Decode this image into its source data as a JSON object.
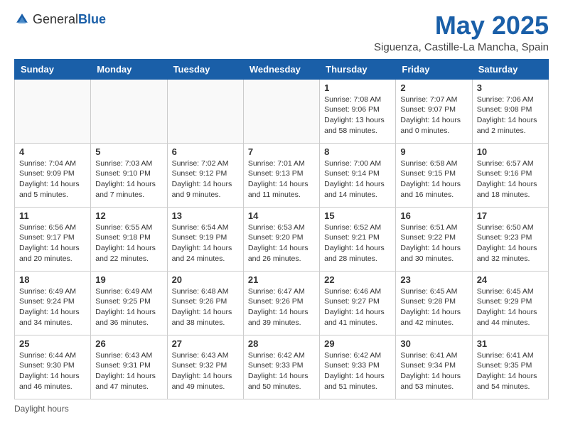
{
  "logo": {
    "general": "General",
    "blue": "Blue"
  },
  "title": "May 2025",
  "location": "Siguenza, Castille-La Mancha, Spain",
  "days_of_week": [
    "Sunday",
    "Monday",
    "Tuesday",
    "Wednesday",
    "Thursday",
    "Friday",
    "Saturday"
  ],
  "footer": "Daylight hours",
  "weeks": [
    [
      {
        "day": "",
        "info": ""
      },
      {
        "day": "",
        "info": ""
      },
      {
        "day": "",
        "info": ""
      },
      {
        "day": "",
        "info": ""
      },
      {
        "day": "1",
        "info": "Sunrise: 7:08 AM\nSunset: 9:06 PM\nDaylight: 13 hours\nand 58 minutes."
      },
      {
        "day": "2",
        "info": "Sunrise: 7:07 AM\nSunset: 9:07 PM\nDaylight: 14 hours\nand 0 minutes."
      },
      {
        "day": "3",
        "info": "Sunrise: 7:06 AM\nSunset: 9:08 PM\nDaylight: 14 hours\nand 2 minutes."
      }
    ],
    [
      {
        "day": "4",
        "info": "Sunrise: 7:04 AM\nSunset: 9:09 PM\nDaylight: 14 hours\nand 5 minutes."
      },
      {
        "day": "5",
        "info": "Sunrise: 7:03 AM\nSunset: 9:10 PM\nDaylight: 14 hours\nand 7 minutes."
      },
      {
        "day": "6",
        "info": "Sunrise: 7:02 AM\nSunset: 9:12 PM\nDaylight: 14 hours\nand 9 minutes."
      },
      {
        "day": "7",
        "info": "Sunrise: 7:01 AM\nSunset: 9:13 PM\nDaylight: 14 hours\nand 11 minutes."
      },
      {
        "day": "8",
        "info": "Sunrise: 7:00 AM\nSunset: 9:14 PM\nDaylight: 14 hours\nand 14 minutes."
      },
      {
        "day": "9",
        "info": "Sunrise: 6:58 AM\nSunset: 9:15 PM\nDaylight: 14 hours\nand 16 minutes."
      },
      {
        "day": "10",
        "info": "Sunrise: 6:57 AM\nSunset: 9:16 PM\nDaylight: 14 hours\nand 18 minutes."
      }
    ],
    [
      {
        "day": "11",
        "info": "Sunrise: 6:56 AM\nSunset: 9:17 PM\nDaylight: 14 hours\nand 20 minutes."
      },
      {
        "day": "12",
        "info": "Sunrise: 6:55 AM\nSunset: 9:18 PM\nDaylight: 14 hours\nand 22 minutes."
      },
      {
        "day": "13",
        "info": "Sunrise: 6:54 AM\nSunset: 9:19 PM\nDaylight: 14 hours\nand 24 minutes."
      },
      {
        "day": "14",
        "info": "Sunrise: 6:53 AM\nSunset: 9:20 PM\nDaylight: 14 hours\nand 26 minutes."
      },
      {
        "day": "15",
        "info": "Sunrise: 6:52 AM\nSunset: 9:21 PM\nDaylight: 14 hours\nand 28 minutes."
      },
      {
        "day": "16",
        "info": "Sunrise: 6:51 AM\nSunset: 9:22 PM\nDaylight: 14 hours\nand 30 minutes."
      },
      {
        "day": "17",
        "info": "Sunrise: 6:50 AM\nSunset: 9:23 PM\nDaylight: 14 hours\nand 32 minutes."
      }
    ],
    [
      {
        "day": "18",
        "info": "Sunrise: 6:49 AM\nSunset: 9:24 PM\nDaylight: 14 hours\nand 34 minutes."
      },
      {
        "day": "19",
        "info": "Sunrise: 6:49 AM\nSunset: 9:25 PM\nDaylight: 14 hours\nand 36 minutes."
      },
      {
        "day": "20",
        "info": "Sunrise: 6:48 AM\nSunset: 9:26 PM\nDaylight: 14 hours\nand 38 minutes."
      },
      {
        "day": "21",
        "info": "Sunrise: 6:47 AM\nSunset: 9:26 PM\nDaylight: 14 hours\nand 39 minutes."
      },
      {
        "day": "22",
        "info": "Sunrise: 6:46 AM\nSunset: 9:27 PM\nDaylight: 14 hours\nand 41 minutes."
      },
      {
        "day": "23",
        "info": "Sunrise: 6:45 AM\nSunset: 9:28 PM\nDaylight: 14 hours\nand 42 minutes."
      },
      {
        "day": "24",
        "info": "Sunrise: 6:45 AM\nSunset: 9:29 PM\nDaylight: 14 hours\nand 44 minutes."
      }
    ],
    [
      {
        "day": "25",
        "info": "Sunrise: 6:44 AM\nSunset: 9:30 PM\nDaylight: 14 hours\nand 46 minutes."
      },
      {
        "day": "26",
        "info": "Sunrise: 6:43 AM\nSunset: 9:31 PM\nDaylight: 14 hours\nand 47 minutes."
      },
      {
        "day": "27",
        "info": "Sunrise: 6:43 AM\nSunset: 9:32 PM\nDaylight: 14 hours\nand 49 minutes."
      },
      {
        "day": "28",
        "info": "Sunrise: 6:42 AM\nSunset: 9:33 PM\nDaylight: 14 hours\nand 50 minutes."
      },
      {
        "day": "29",
        "info": "Sunrise: 6:42 AM\nSunset: 9:33 PM\nDaylight: 14 hours\nand 51 minutes."
      },
      {
        "day": "30",
        "info": "Sunrise: 6:41 AM\nSunset: 9:34 PM\nDaylight: 14 hours\nand 53 minutes."
      },
      {
        "day": "31",
        "info": "Sunrise: 6:41 AM\nSunset: 9:35 PM\nDaylight: 14 hours\nand 54 minutes."
      }
    ]
  ]
}
